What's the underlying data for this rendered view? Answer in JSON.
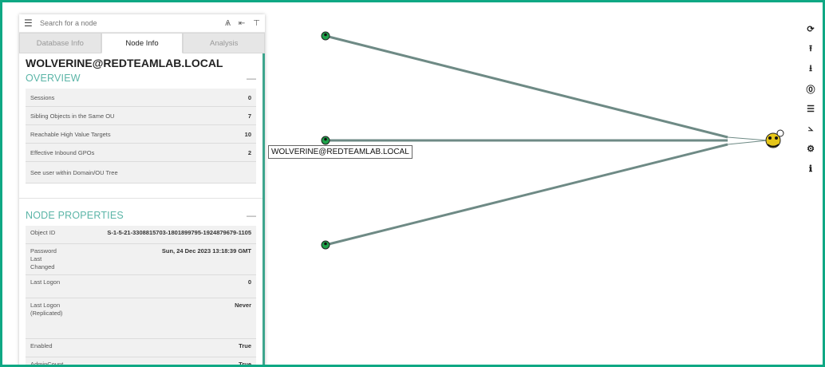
{
  "search": {
    "placeholder": "Search for a node"
  },
  "search_icons": {
    "pathfinding": "Ѧ",
    "back": "⇤",
    "filter": "⊤"
  },
  "tabs": [
    {
      "label": "Database Info"
    },
    {
      "label": "Node Info"
    },
    {
      "label": "Analysis"
    }
  ],
  "node": {
    "name": "WOLVERINE@REDTEAMLAB.LOCAL"
  },
  "overview": {
    "title": "OVERVIEW",
    "collapse": "—",
    "rows": [
      {
        "label": "Sessions",
        "value": "0"
      },
      {
        "label": "Sibling Objects in the Same OU",
        "value": "7"
      },
      {
        "label": "Reachable High Value Targets",
        "value": "10"
      },
      {
        "label": "Effective Inbound GPOs",
        "value": "2"
      },
      {
        "label": "See user within Domain/OU Tree",
        "value": ""
      }
    ]
  },
  "properties": {
    "title": "NODE PROPERTIES",
    "collapse": "—",
    "rows": [
      {
        "label": "Object ID",
        "value": "S-1-5-21-3308815703-1801899795-1924879679-1105"
      },
      {
        "label": "Password Last Changed",
        "value": "Sun, 24 Dec 2023 13:18:39 GMT"
      },
      {
        "label": "Last Logon",
        "value": "0"
      },
      {
        "label": "Last Logon (Replicated)",
        "value": "Never"
      },
      {
        "label": "Enabled",
        "value": "True"
      },
      {
        "label": "AdminCount",
        "value": "True"
      }
    ]
  },
  "graph": {
    "center_label": "WOLVERINE@REDTEAMLAB.LOCAL",
    "colors": {
      "edge": "#6e8a85",
      "node": "#1fa14a",
      "group": "#e6c619",
      "border": "#0fa884"
    }
  },
  "toolbar": [
    {
      "icon": "refresh-icon",
      "glyph": "⟳"
    },
    {
      "icon": "upload-icon",
      "glyph": "⭱"
    },
    {
      "icon": "download-icon",
      "glyph": "⭳"
    },
    {
      "icon": "info-circle-icon",
      "glyph": "⓪"
    },
    {
      "icon": "list-icon",
      "glyph": "☰"
    },
    {
      "icon": "chart-icon",
      "glyph": "⦣"
    },
    {
      "icon": "settings-icon",
      "glyph": "⚙"
    },
    {
      "icon": "about-icon",
      "glyph": "ℹ"
    }
  ]
}
